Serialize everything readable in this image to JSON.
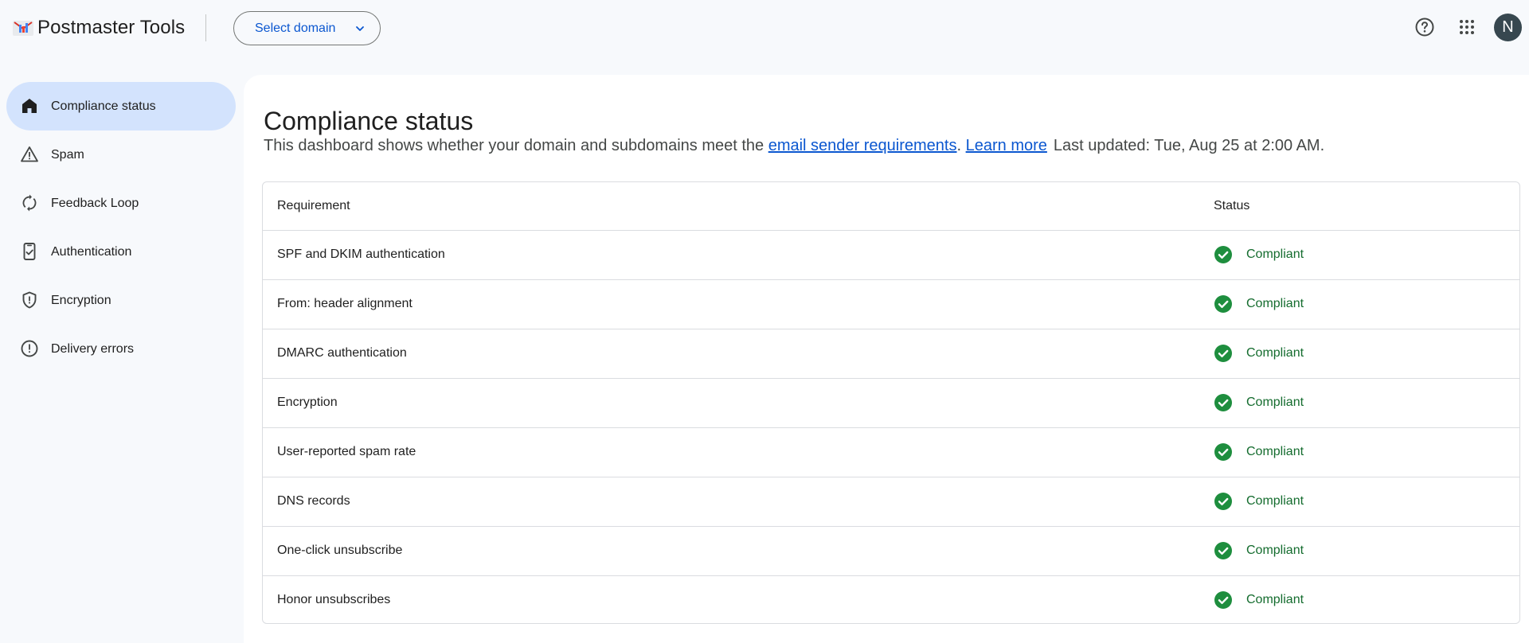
{
  "header": {
    "app_title": "Postmaster Tools",
    "domain_select_label": "Select domain",
    "avatar_initial": "N"
  },
  "sidebar": {
    "items": [
      {
        "label": "Compliance status",
        "icon": "home-icon",
        "active": true
      },
      {
        "label": "Spam",
        "icon": "warning-icon",
        "active": false
      },
      {
        "label": "Feedback Loop",
        "icon": "sync-icon",
        "active": false
      },
      {
        "label": "Authentication",
        "icon": "phone-check-icon",
        "active": false
      },
      {
        "label": "Encryption",
        "icon": "shield-icon",
        "active": false
      },
      {
        "label": "Delivery errors",
        "icon": "error-circle-icon",
        "active": false
      }
    ]
  },
  "main": {
    "title": "Compliance status",
    "subtitle_prefix": "This dashboard shows whether your domain and subdomains meet the ",
    "subtitle_link": "email sender requirements",
    "subtitle_period": ".",
    "learn_more": "Learn more",
    "last_updated": "Last updated: Tue, Aug 25 at 2:00 AM."
  },
  "table": {
    "headers": {
      "requirement": "Requirement",
      "status": "Status"
    },
    "rows": [
      {
        "requirement": "SPF and DKIM authentication",
        "status": "Compliant"
      },
      {
        "requirement": "From: header alignment",
        "status": "Compliant"
      },
      {
        "requirement": "DMARC authentication",
        "status": "Compliant"
      },
      {
        "requirement": "Encryption",
        "status": "Compliant"
      },
      {
        "requirement": "User-reported spam rate",
        "status": "Compliant"
      },
      {
        "requirement": "DNS records",
        "status": "Compliant"
      },
      {
        "requirement": "One-click unsubscribe",
        "status": "Compliant"
      },
      {
        "requirement": "Honor unsubscribes",
        "status": "Compliant"
      }
    ]
  },
  "colors": {
    "accent": "#0b57d0",
    "active_nav_bg": "#d3e3fd",
    "compliant_green": "#146c2e",
    "check_icon_green": "#1e8e3e",
    "avatar_bg": "#37474f"
  }
}
